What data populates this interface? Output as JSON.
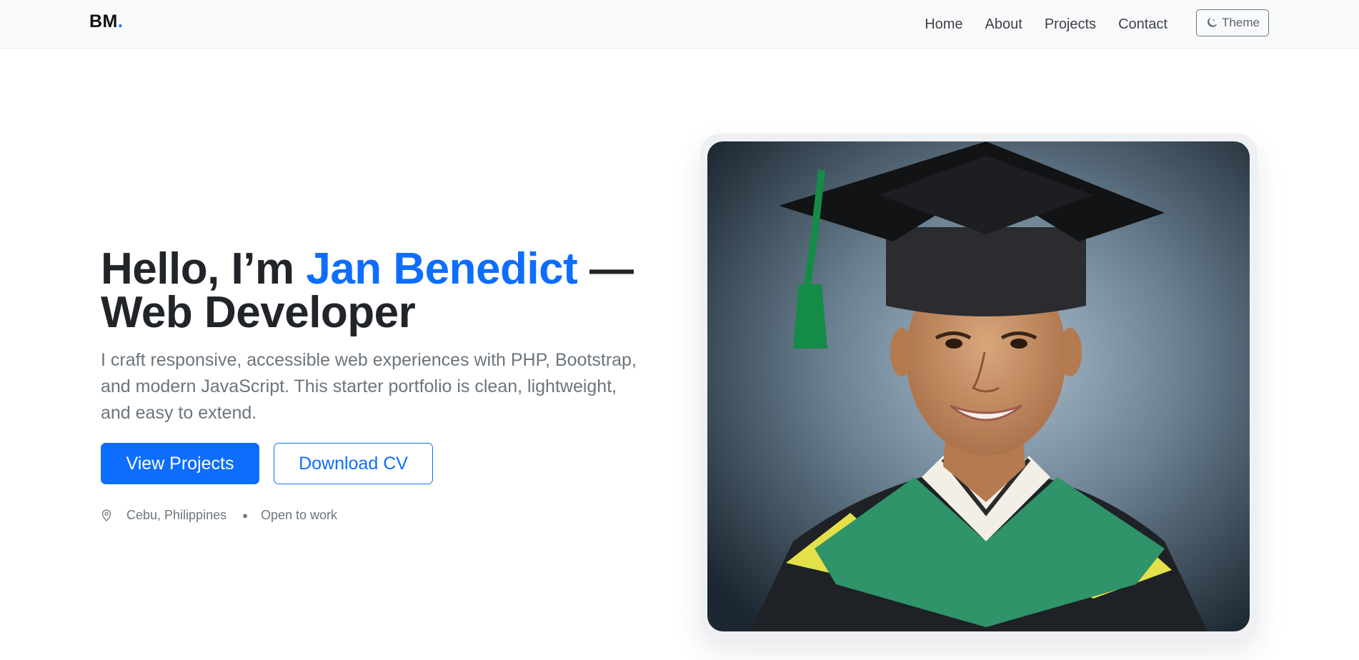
{
  "navbar": {
    "brand": "BM",
    "brand_dot": ".",
    "links": [
      "Home",
      "About",
      "Projects",
      "Contact"
    ],
    "theme_label": "Theme",
    "theme_icon": "moon-stars-icon"
  },
  "hero": {
    "title_prefix": "Hello, I’m ",
    "name": "Jan Benedict",
    "title_suffix": " —",
    "title_line2": "Web Developer",
    "lead": "I craft responsive, accessible web experiences with PHP, Bootstrap, and modern JavaScript. This starter portfolio is clean, lightweight, and easy to extend.",
    "primary_button": "View Projects",
    "secondary_button": "Download CV",
    "location": "Cebu, Philippines",
    "location_icon": "map-pin-icon",
    "separator": "●",
    "status": "Open to work"
  },
  "colors": {
    "accent": "#0d6efd",
    "navbar_bg": "#f8f9fa",
    "text_dark": "#212529",
    "text_muted": "#6c757d"
  }
}
